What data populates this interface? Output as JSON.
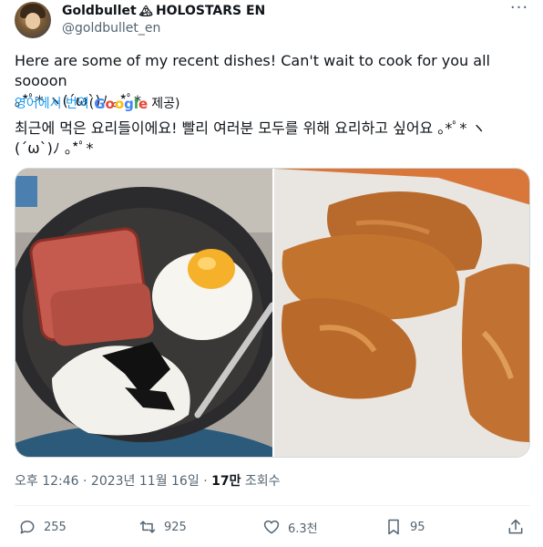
{
  "author": {
    "display_name": "Goldbullet",
    "badge_emoji": "🏔",
    "affiliation": "HOLOSTARS EN",
    "handle": "@goldbullet_en"
  },
  "tweet": {
    "text": "Here are some of my recent dishes! Can't wait to cook for you all soooon\n｡*ﾟ* ヽ(´ω`)ﾉ ｡*ﾟ*",
    "translate_link": "영어에서 번역",
    "translate_paren_open": "(",
    "translate_paren_close": ")",
    "translate_provider_suffix": "제공",
    "translated_text": "최근에 먹은 요리들이에요! 빨리 여러분 모두를 위해 요리하고 싶어요 ｡*ﾟ* ヽ\n(´ω`)ﾉ ｡*ﾟ*"
  },
  "meta": {
    "time": "오후 12:46",
    "sep": "·",
    "date": "2023년 11월 16일",
    "views_count": "17만",
    "views_label": "조회수"
  },
  "actions": {
    "replies": "255",
    "reposts": "925",
    "likes": "6.3천",
    "bookmarks": "95"
  },
  "colors": {
    "accent": "#1d9bf0",
    "secondary_text": "#536471"
  },
  "icons": [
    "more-icon",
    "reply-icon",
    "repost-icon",
    "like-icon",
    "bookmark-icon",
    "share-icon"
  ]
}
